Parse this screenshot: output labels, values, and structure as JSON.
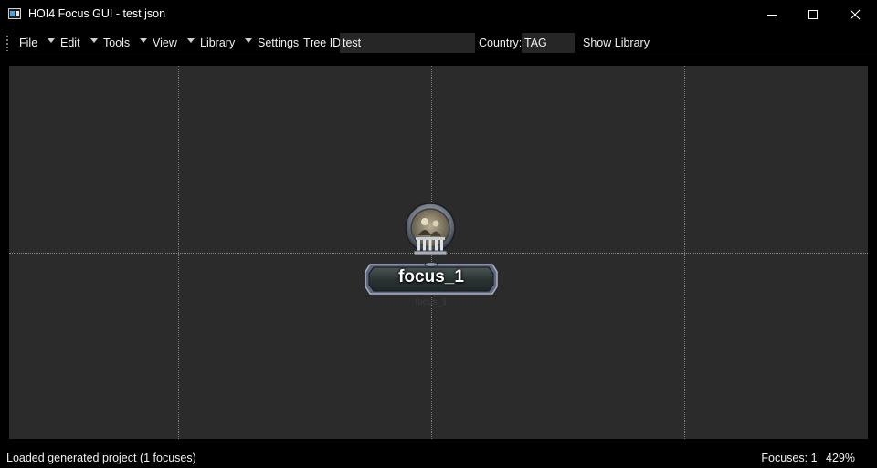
{
  "window": {
    "title": "HOI4 Focus GUI - test.json",
    "controls": [
      "minimize-icon",
      "maximize-icon",
      "close-icon"
    ]
  },
  "toolbar": {
    "menus": [
      {
        "label": "File"
      },
      {
        "label": "Edit"
      },
      {
        "label": "Tools"
      },
      {
        "label": "View"
      },
      {
        "label": "Library"
      }
    ],
    "settings_label": "Settings",
    "tree_id_label": "Tree ID:",
    "tree_id_value": "test",
    "country_label": "Country:",
    "country_value": "TAG",
    "show_library_label": "Show Library"
  },
  "canvas": {
    "focus": {
      "name": "focus_1",
      "subtitle": "focus_1",
      "icon": "focus-goal-icon"
    }
  },
  "status": {
    "message": "Loaded generated project (1 focuses)",
    "focus_count": "Focuses: 1",
    "zoom": "429%"
  },
  "colors": {
    "background": "#000000",
    "canvas": "#2b2b2b",
    "grid_line": "#7a7a7a",
    "plate_border": "#8a96b4",
    "plate_fill": "#2e3a3a"
  }
}
